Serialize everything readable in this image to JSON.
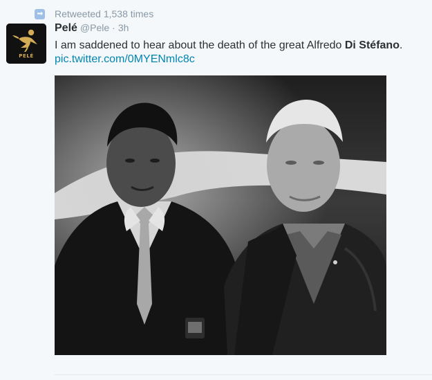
{
  "retweet": {
    "icon": "retweet-icon",
    "text": "Retweeted 1,538 times"
  },
  "author": {
    "name": "Pelé",
    "handle": "@Pele",
    "time": "3h",
    "avatar_label": "PELÉ"
  },
  "tweet": {
    "text_prefix": "I am saddened to hear about the death of the great Alfredo ",
    "text_bold": "Di Stéfano",
    "text_suffix": ".",
    "media_link": "pic.twitter.com/0MYENmlc8c"
  },
  "colors": {
    "link": "#0084b4",
    "muted": "#8899a6",
    "text": "#292f33",
    "brand": "#d3ac55"
  }
}
